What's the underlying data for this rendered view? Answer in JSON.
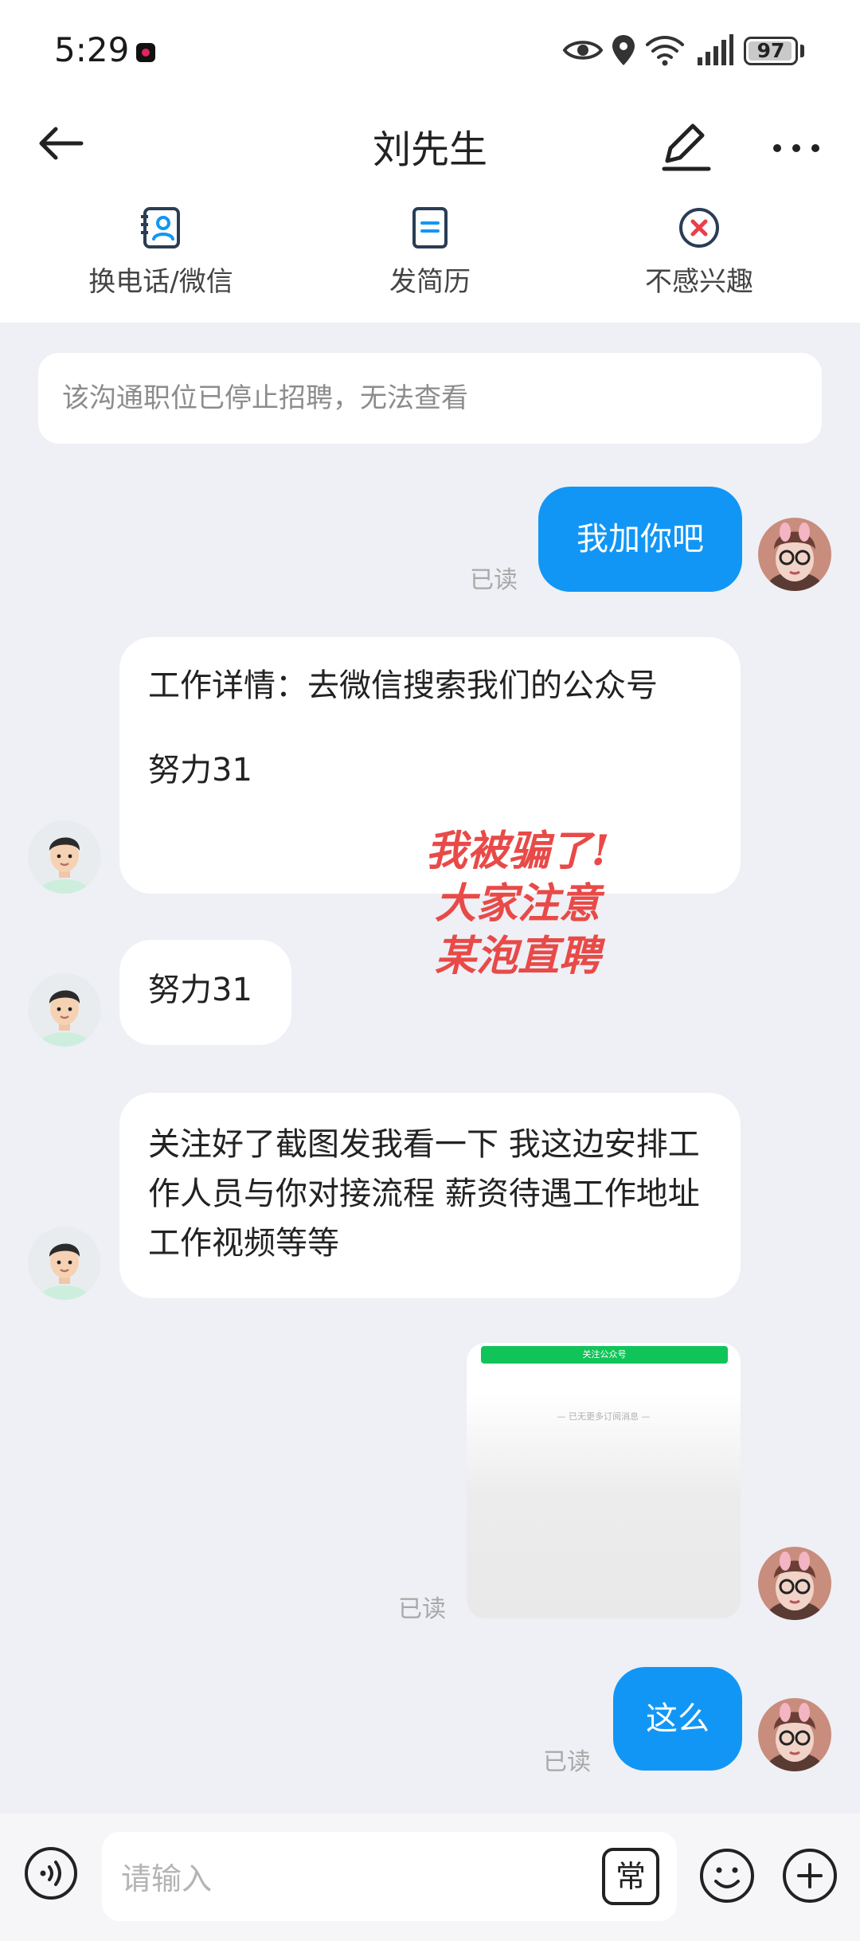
{
  "status_bar": {
    "time": "5:29",
    "battery": "97",
    "battery_level": 0.97
  },
  "header": {
    "title": "刘先生"
  },
  "actions": {
    "contact_label": "换电话/微信",
    "resume_label": "发简历",
    "not_interested_label": "不感兴趣"
  },
  "chat": {
    "notice": "该沟通职位已停止招聘，无法查看",
    "msg1": "我加你吧",
    "msg2_line1": "工作详情：去微信搜索我们的公众号",
    "msg2_line2": "努力31",
    "msg3": "努力31",
    "msg4": "关注好了截图发我看一下  我这边安排工作人员与你对接流程 薪资待遇工作地址 工作视频等等",
    "image_header": "关注公众号",
    "image_caption": "— 已无更多订阅消息 —",
    "msg5": "这么",
    "read_label": "已读"
  },
  "overlay": {
    "line1": "我被骗了!",
    "line2": "大家注意",
    "line3": "某泡直聘"
  },
  "input": {
    "placeholder": "请输入",
    "quick_reply": "常"
  },
  "colors": {
    "accent": "#1296f5",
    "overlay_red": "#e84a48",
    "wechat_green": "#11c45a"
  },
  "icons": [
    "back-arrow-icon",
    "edit-icon",
    "more-icon",
    "contact-card-icon",
    "document-icon",
    "close-circle-icon",
    "eye-icon",
    "location-icon",
    "wifi-icon",
    "signal-icon",
    "voice-icon",
    "emoji-icon",
    "plus-icon"
  ]
}
